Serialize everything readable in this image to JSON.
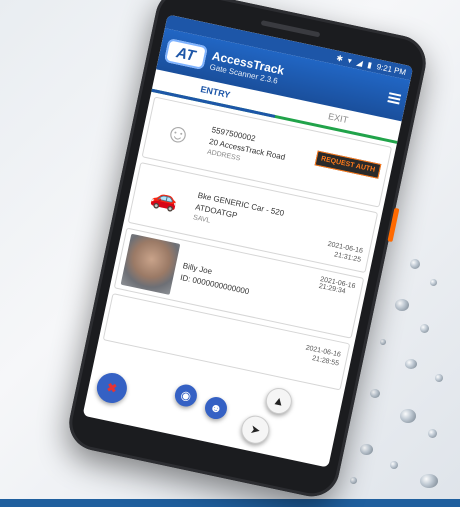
{
  "status_bar": {
    "time": "9:21 PM",
    "icons": [
      "bluetooth-icon",
      "wifi-icon",
      "signal-icon",
      "battery-icon"
    ]
  },
  "app": {
    "logo_text": "AT",
    "title": "AccessTrack",
    "subtitle": "Gate Scanner 2.3.6"
  },
  "tabs": [
    {
      "label": "ENTRY",
      "active": true
    },
    {
      "label": "EXIT",
      "active": false
    }
  ],
  "entries": [
    {
      "id_number": "5597500002",
      "line1": "20 AccessTrack Road",
      "line2": "ADDRESS",
      "action_label": "REQUEST AUTH"
    },
    {
      "line1": "Bke GENERIC Car - 520",
      "line2": "ATDOATGP",
      "line3": "SAVL",
      "date": "2021-06-16",
      "time": "21:31:25"
    },
    {
      "name": "Billy Joe",
      "id_label": "ID: 0000000000000",
      "date": "2021-06-16",
      "time": "21:29:34"
    },
    {
      "date": "2021-06-16",
      "time": "21:28:55"
    }
  ],
  "colors": {
    "brand_blue": "#1d56a8",
    "accent_green": "#21a34a",
    "accent_orange": "#ff7a1a"
  }
}
